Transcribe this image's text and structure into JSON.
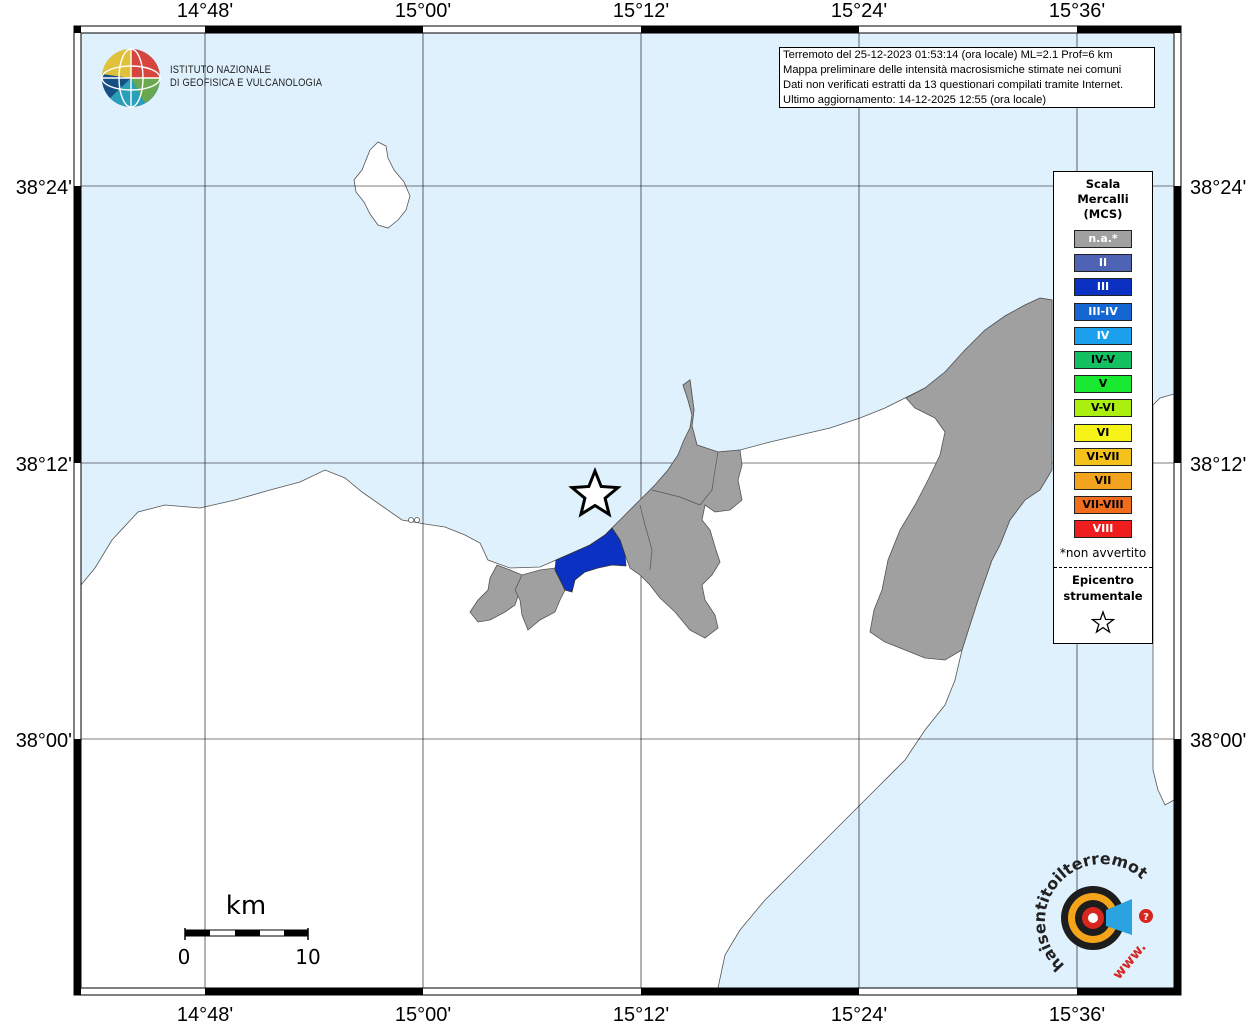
{
  "axes": {
    "lon_labels": [
      "14°48'",
      "15°00'",
      "15°12'",
      "15°24'",
      "15°36'"
    ],
    "lat_labels": [
      "38°24'",
      "38°12'",
      "38°00'"
    ]
  },
  "info_box": {
    "line1": "Terremoto del 25-12-2023 01:53:14 (ora locale) ML=2.1 Prof=6 km",
    "line2": "Mappa preliminare delle intensità macrosismiche stimate nei comuni",
    "line3": "Dati non verificati estratti da 13 questionari compilati tramite Internet.",
    "line4": "Ultimo aggiornamento: 14-12-2025 12:55 (ora locale)"
  },
  "logo": {
    "line1": "ISTITUTO NAZIONALE",
    "line2": "DI GEOFISICA E VULCANOLOGIA",
    "icon": "ingv-globe-logo"
  },
  "legend": {
    "title_line1": "Scala",
    "title_line2": "Mercalli",
    "title_line3": "(MCS)",
    "items": [
      {
        "label": "n.a.*",
        "color": "#a0a0a0",
        "text": "#ffffff"
      },
      {
        "label": "II",
        "color": "#4e63b4",
        "text": "#ffffff"
      },
      {
        "label": "III",
        "color": "#0a31c2",
        "text": "#ffffff"
      },
      {
        "label": "III-IV",
        "color": "#1467d3",
        "text": "#ffffff"
      },
      {
        "label": "IV",
        "color": "#1aa0ec",
        "text": "#ffffff"
      },
      {
        "label": "IV-V",
        "color": "#13c162",
        "text": "#000000"
      },
      {
        "label": "V",
        "color": "#19e930",
        "text": "#000000"
      },
      {
        "label": "V-VI",
        "color": "#aaef10",
        "text": "#000000"
      },
      {
        "label": "VI",
        "color": "#f5f318",
        "text": "#000000"
      },
      {
        "label": "VI-VII",
        "color": "#f4c21b",
        "text": "#000000"
      },
      {
        "label": "VII",
        "color": "#f3a31e",
        "text": "#000000"
      },
      {
        "label": "VII-VIII",
        "color": "#f06d1e",
        "text": "#000000"
      },
      {
        "label": "VIII",
        "color": "#ef1d1d",
        "text": "#ffffff"
      }
    ],
    "note": "*non avvertito",
    "epicenter_line1": "Epicentro",
    "epicenter_line2": "strumentale",
    "epicenter_icon": "star-icon"
  },
  "scale_bar": {
    "unit": "km",
    "min_label": "0",
    "max_label": "10"
  },
  "watermark": {
    "text": "haisentitoilterremoto.it",
    "text2": "www.",
    "icon": "haisentito-logo"
  },
  "colors": {
    "sea": "#dff1fd",
    "land": "#ffffff",
    "na_fill": "#a0a0a0",
    "iii_fill": "#0a31c2"
  }
}
